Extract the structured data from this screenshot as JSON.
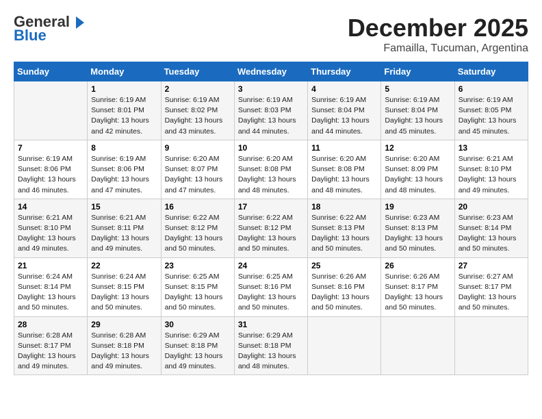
{
  "logo": {
    "line1": "General",
    "line2": "Blue"
  },
  "title": "December 2025",
  "location": "Famailla, Tucuman, Argentina",
  "days_of_week": [
    "Sunday",
    "Monday",
    "Tuesday",
    "Wednesday",
    "Thursday",
    "Friday",
    "Saturday"
  ],
  "weeks": [
    [
      {
        "day": "",
        "sunrise": "",
        "sunset": "",
        "daylight": ""
      },
      {
        "day": "1",
        "sunrise": "6:19 AM",
        "sunset": "8:01 PM",
        "daylight": "13 hours and 42 minutes."
      },
      {
        "day": "2",
        "sunrise": "6:19 AM",
        "sunset": "8:02 PM",
        "daylight": "13 hours and 43 minutes."
      },
      {
        "day": "3",
        "sunrise": "6:19 AM",
        "sunset": "8:03 PM",
        "daylight": "13 hours and 44 minutes."
      },
      {
        "day": "4",
        "sunrise": "6:19 AM",
        "sunset": "8:04 PM",
        "daylight": "13 hours and 44 minutes."
      },
      {
        "day": "5",
        "sunrise": "6:19 AM",
        "sunset": "8:04 PM",
        "daylight": "13 hours and 45 minutes."
      },
      {
        "day": "6",
        "sunrise": "6:19 AM",
        "sunset": "8:05 PM",
        "daylight": "13 hours and 45 minutes."
      }
    ],
    [
      {
        "day": "7",
        "sunrise": "6:19 AM",
        "sunset": "8:06 PM",
        "daylight": "13 hours and 46 minutes."
      },
      {
        "day": "8",
        "sunrise": "6:19 AM",
        "sunset": "8:06 PM",
        "daylight": "13 hours and 47 minutes."
      },
      {
        "day": "9",
        "sunrise": "6:20 AM",
        "sunset": "8:07 PM",
        "daylight": "13 hours and 47 minutes."
      },
      {
        "day": "10",
        "sunrise": "6:20 AM",
        "sunset": "8:08 PM",
        "daylight": "13 hours and 48 minutes."
      },
      {
        "day": "11",
        "sunrise": "6:20 AM",
        "sunset": "8:08 PM",
        "daylight": "13 hours and 48 minutes."
      },
      {
        "day": "12",
        "sunrise": "6:20 AM",
        "sunset": "8:09 PM",
        "daylight": "13 hours and 48 minutes."
      },
      {
        "day": "13",
        "sunrise": "6:21 AM",
        "sunset": "8:10 PM",
        "daylight": "13 hours and 49 minutes."
      }
    ],
    [
      {
        "day": "14",
        "sunrise": "6:21 AM",
        "sunset": "8:10 PM",
        "daylight": "13 hours and 49 minutes."
      },
      {
        "day": "15",
        "sunrise": "6:21 AM",
        "sunset": "8:11 PM",
        "daylight": "13 hours and 49 minutes."
      },
      {
        "day": "16",
        "sunrise": "6:22 AM",
        "sunset": "8:12 PM",
        "daylight": "13 hours and 50 minutes."
      },
      {
        "day": "17",
        "sunrise": "6:22 AM",
        "sunset": "8:12 PM",
        "daylight": "13 hours and 50 minutes."
      },
      {
        "day": "18",
        "sunrise": "6:22 AM",
        "sunset": "8:13 PM",
        "daylight": "13 hours and 50 minutes."
      },
      {
        "day": "19",
        "sunrise": "6:23 AM",
        "sunset": "8:13 PM",
        "daylight": "13 hours and 50 minutes."
      },
      {
        "day": "20",
        "sunrise": "6:23 AM",
        "sunset": "8:14 PM",
        "daylight": "13 hours and 50 minutes."
      }
    ],
    [
      {
        "day": "21",
        "sunrise": "6:24 AM",
        "sunset": "8:14 PM",
        "daylight": "13 hours and 50 minutes."
      },
      {
        "day": "22",
        "sunrise": "6:24 AM",
        "sunset": "8:15 PM",
        "daylight": "13 hours and 50 minutes."
      },
      {
        "day": "23",
        "sunrise": "6:25 AM",
        "sunset": "8:15 PM",
        "daylight": "13 hours and 50 minutes."
      },
      {
        "day": "24",
        "sunrise": "6:25 AM",
        "sunset": "8:16 PM",
        "daylight": "13 hours and 50 minutes."
      },
      {
        "day": "25",
        "sunrise": "6:26 AM",
        "sunset": "8:16 PM",
        "daylight": "13 hours and 50 minutes."
      },
      {
        "day": "26",
        "sunrise": "6:26 AM",
        "sunset": "8:17 PM",
        "daylight": "13 hours and 50 minutes."
      },
      {
        "day": "27",
        "sunrise": "6:27 AM",
        "sunset": "8:17 PM",
        "daylight": "13 hours and 50 minutes."
      }
    ],
    [
      {
        "day": "28",
        "sunrise": "6:28 AM",
        "sunset": "8:17 PM",
        "daylight": "13 hours and 49 minutes."
      },
      {
        "day": "29",
        "sunrise": "6:28 AM",
        "sunset": "8:18 PM",
        "daylight": "13 hours and 49 minutes."
      },
      {
        "day": "30",
        "sunrise": "6:29 AM",
        "sunset": "8:18 PM",
        "daylight": "13 hours and 49 minutes."
      },
      {
        "day": "31",
        "sunrise": "6:29 AM",
        "sunset": "8:18 PM",
        "daylight": "13 hours and 48 minutes."
      },
      {
        "day": "",
        "sunrise": "",
        "sunset": "",
        "daylight": ""
      },
      {
        "day": "",
        "sunrise": "",
        "sunset": "",
        "daylight": ""
      },
      {
        "day": "",
        "sunrise": "",
        "sunset": "",
        "daylight": ""
      }
    ]
  ]
}
